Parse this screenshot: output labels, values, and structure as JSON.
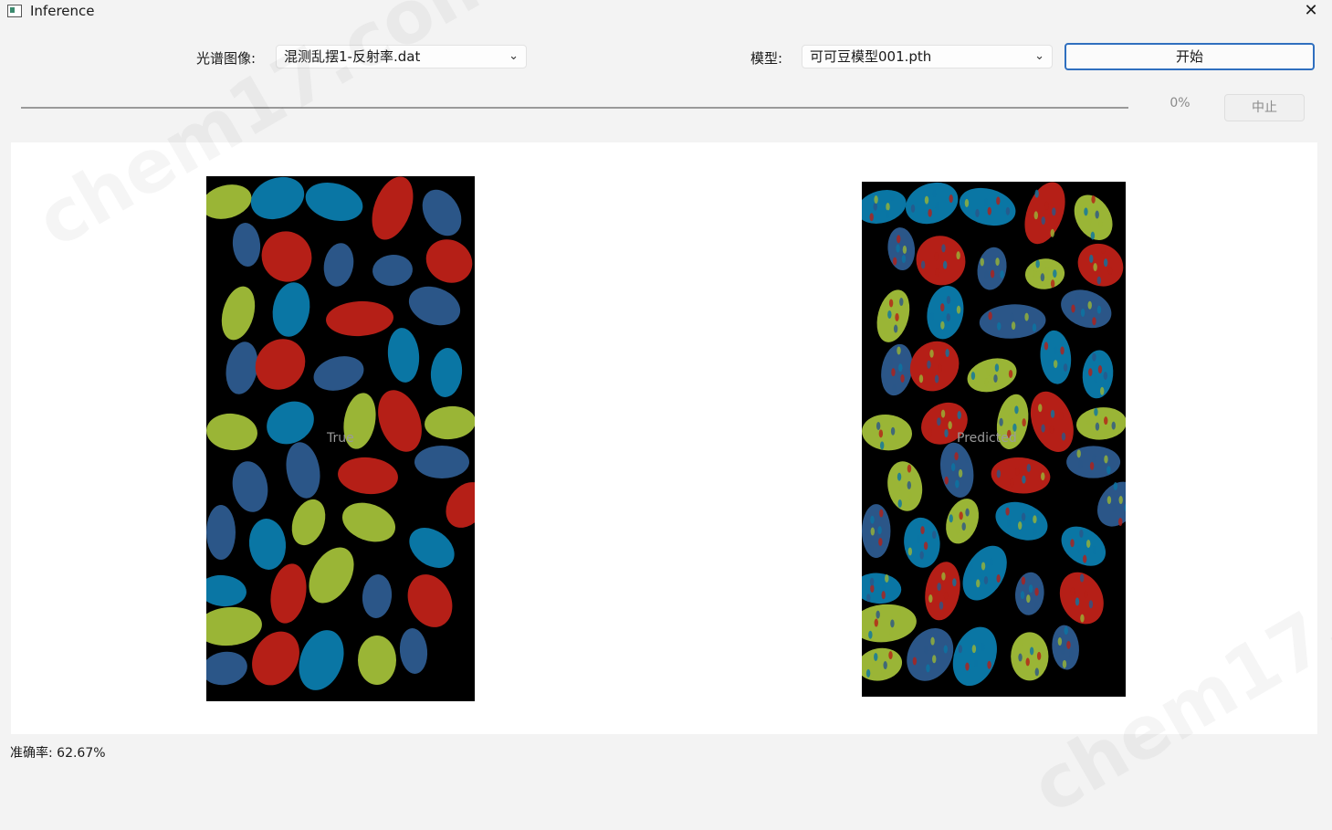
{
  "window": {
    "title": "Inference",
    "close_glyph": "✕"
  },
  "controls": {
    "spectral_label": "光谱图像:",
    "spectral_value": "混测乱摆1-反射率.dat",
    "model_label": "模型:",
    "model_value": "可可豆模型001.pth",
    "start_label": "开始",
    "stop_label": "中止",
    "progress_text": "0%",
    "progress_value": 0
  },
  "panels": {
    "true_caption": "True",
    "predicted_caption": "Predicted"
  },
  "colors": {
    "class_a": "#9ab536",
    "class_b": "#0a76a4",
    "class_c": "#b51f17",
    "class_d": "#2b5688"
  },
  "status": {
    "accuracy": "准确率: 62.67%"
  },
  "watermark": "chem17.com"
}
